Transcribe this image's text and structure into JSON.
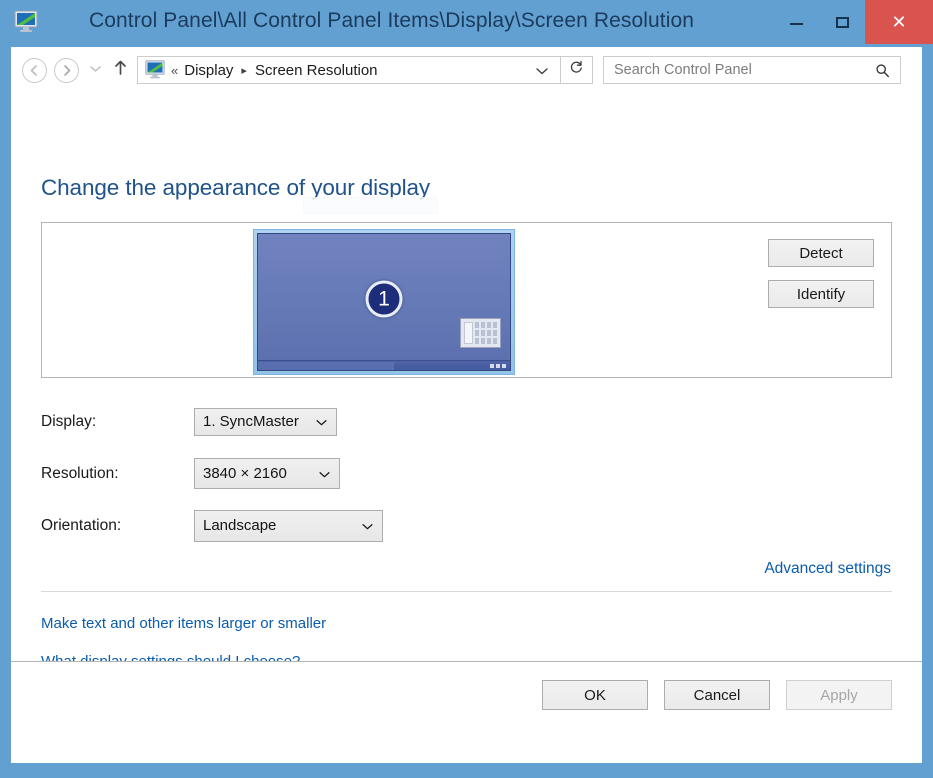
{
  "window": {
    "title": "Control Panel\\All Control Panel Items\\Display\\Screen Resolution",
    "icon": "display-monitor-icon",
    "controls": {
      "minimize": "minimize-icon",
      "maximize": "maximize-icon",
      "close": "✕"
    },
    "accent_color": "#62a0d2",
    "close_color": "#d9534f"
  },
  "navbar": {
    "back": "back-arrow-icon",
    "forward": "forward-arrow-icon",
    "history_dropdown": "chevron-down-icon",
    "up": "up-arrow-icon",
    "address_icon": "display-monitor-icon",
    "breadcrumb_prefix": "«",
    "breadcrumbs": [
      {
        "label": "Display"
      },
      {
        "label": "Screen Resolution"
      }
    ],
    "breadcrumb_separator": "▸",
    "address_caret": "chevron-down-icon",
    "refresh": "refresh-icon"
  },
  "search": {
    "placeholder": "Search Control Panel",
    "value": "",
    "icon": "search-icon"
  },
  "main": {
    "page_title": "Change the appearance of your display",
    "preview": {
      "monitor_number": "1",
      "start_tiles_icon": "start-tiles-icon"
    },
    "side_buttons": {
      "detect": "Detect",
      "identify": "Identify"
    },
    "settings": [
      {
        "label": "Display:",
        "value": "1. SyncMaster",
        "caret": "chevron-down-icon"
      },
      {
        "label": "Resolution:",
        "value": "3840 × 2160",
        "caret": "chevron-down-icon"
      },
      {
        "label": "Orientation:",
        "value": "Landscape",
        "caret": "chevron-down-icon"
      }
    ],
    "advanced_link": "Advanced settings",
    "links": [
      "Make text and other items larger or smaller",
      "What display settings should I choose?"
    ],
    "link_color": "#0a5cad",
    "title_color": "#20538c"
  },
  "footer": {
    "ok": "OK",
    "cancel": "Cancel",
    "apply": "Apply",
    "apply_disabled": true
  }
}
